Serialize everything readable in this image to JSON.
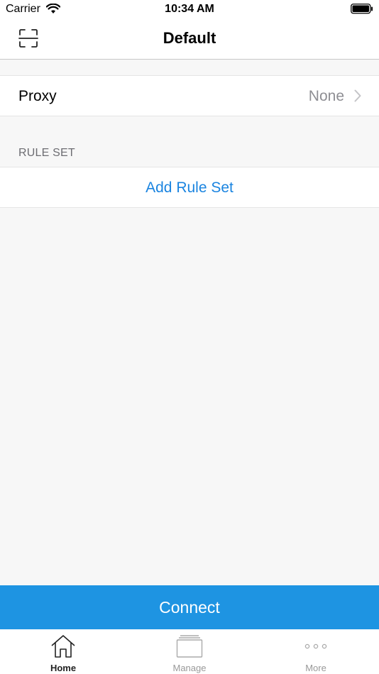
{
  "status_bar": {
    "carrier": "Carrier",
    "time": "10:34 AM",
    "wifi_icon": "wifi-icon",
    "battery_icon": "battery-icon"
  },
  "nav": {
    "title": "Default",
    "left_icon": "scan-icon"
  },
  "proxy": {
    "label": "Proxy",
    "value": "None",
    "chevron_icon": "chevron-right-icon"
  },
  "rule_set": {
    "section_title": "RULE SET",
    "add_label": "Add Rule Set"
  },
  "connect": {
    "label": "Connect"
  },
  "tabs": [
    {
      "label": "Home",
      "icon": "home-icon",
      "active": true
    },
    {
      "label": "Manage",
      "icon": "manage-icon",
      "active": false
    },
    {
      "label": "More",
      "icon": "more-icon",
      "active": false
    }
  ],
  "colors": {
    "accent": "#1e94e2",
    "link": "#1a84e0",
    "secondary_text": "#8e8e93",
    "background": "#f7f7f7"
  }
}
